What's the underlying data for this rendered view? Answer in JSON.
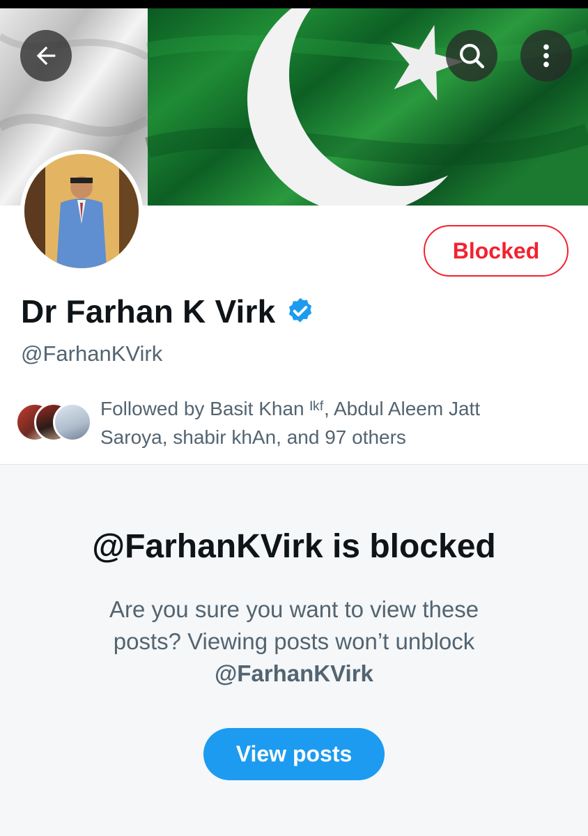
{
  "profile": {
    "display_name": "Dr Farhan K Virk",
    "handle": "@FarhanKVirk",
    "verified": true,
    "blocked_label": "Blocked",
    "followed_by_text": "Followed by Basit Khan ᴵᵏᶠ, Abdul Aleem Jatt Saroya, shabir khAn, and 97 others"
  },
  "header": {
    "back_icon": "arrow-left-icon",
    "search_icon": "search-icon",
    "more_icon": "more-vertical-icon"
  },
  "blocked_notice": {
    "title": "@FarhanKVirk is blocked",
    "description": "Are you sure you want to view these posts? Viewing posts won’t unblock",
    "description_handle": "@FarhanKVirk",
    "view_button": "View posts"
  },
  "colors": {
    "accent": "#1d9bf0",
    "blocked_red": "#f4212e",
    "secondary_text": "#536471",
    "flag_green": "#01411c"
  }
}
